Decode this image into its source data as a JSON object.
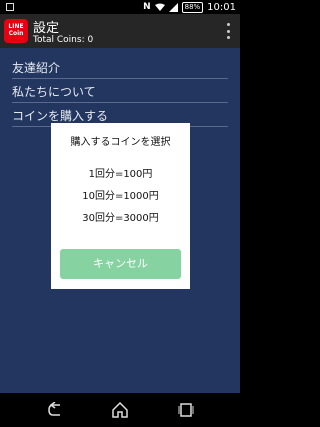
{
  "status": {
    "battery": "88%",
    "time": "10:01",
    "nfc": "N"
  },
  "app": {
    "logo_text_1": "LINE",
    "logo_text_2": "Coin",
    "title": "設定",
    "subtitle": "Total Coins: 0"
  },
  "menu": [
    {
      "label": "友達紹介"
    },
    {
      "label": "私たちについて"
    },
    {
      "label": "コインを購入する"
    }
  ],
  "dialog": {
    "title": "購入するコインを選択",
    "options": [
      {
        "label": "1回分=100円"
      },
      {
        "label": "10回分=1000円"
      },
      {
        "label": "30回分=3000円"
      }
    ],
    "cancel_label": "キャンセル"
  },
  "colors": {
    "accent": "#86d3a1",
    "background": "#233660",
    "app_bar": "#262626",
    "logo": "#e60012"
  }
}
